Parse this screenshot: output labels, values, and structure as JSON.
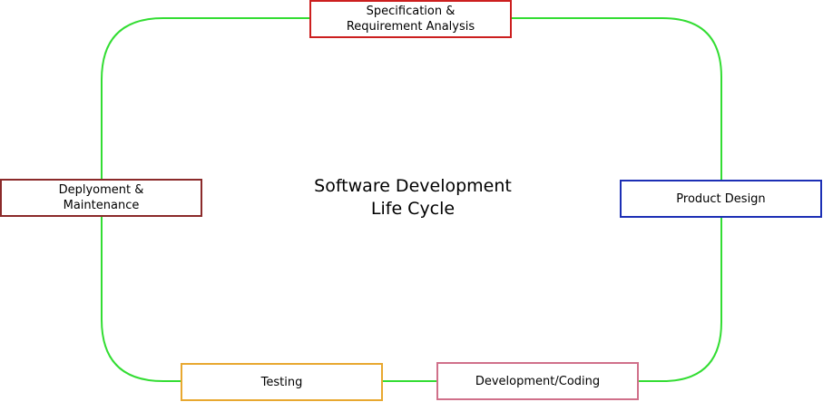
{
  "diagram": {
    "title_lines": [
      "Software Development",
      "Life Cycle"
    ],
    "loop_color": "#33dd33",
    "stages": [
      {
        "id": "spec",
        "lines": [
          "Specification &",
          "Requirement Analysis"
        ],
        "border_color": "#cc1f1f"
      },
      {
        "id": "design",
        "lines": [
          "Product Design"
        ],
        "border_color": "#1c2fb5"
      },
      {
        "id": "coding",
        "lines": [
          "Development/Coding"
        ],
        "border_color": "#d0708a"
      },
      {
        "id": "testing",
        "lines": [
          "Testing"
        ],
        "border_color": "#e8a830"
      },
      {
        "id": "deploy",
        "lines": [
          "Deplyoment &",
          "Maintenance"
        ],
        "border_color": "#8b2a2a"
      }
    ]
  }
}
